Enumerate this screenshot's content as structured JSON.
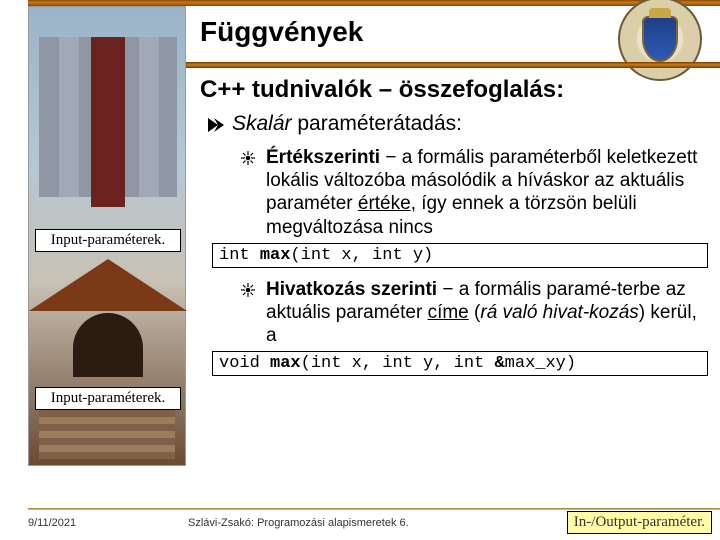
{
  "header": {
    "title": "Függvények",
    "subtitle": "C++ tudnivalók – összefoglalás:"
  },
  "left": {
    "label1": "Input-paraméterek.",
    "label2": "Input-paraméterek."
  },
  "body": {
    "l1_prefix_italic": "Skalár",
    "l1_rest": " paraméterátadás:",
    "item1_bold": "Értékszerinti",
    "item1_dash": " − ",
    "item1_rest": "a formális paraméterből keletkezett lokális változóba másolódik a híváskor az aktuális paraméter ",
    "item1_ul": "értéke",
    "item1_rest2": ", így ennek a törzsön belüli megváltozása nincs",
    "code1_prefix": "int ",
    "code1_bold": "max",
    "code1_rest": "(int x, int y)",
    "item2_bold": "Hivatkozás szerinti",
    "item2_dash": " − ",
    "item2_rest": "a formális paramé-terbe az aktuális paraméter ",
    "item2_ul": "címe",
    "item2_rest2": " (",
    "item2_ital": "rá való hivat-kozás",
    "item2_rest3": ") kerül, a",
    "code2_prefix": "void ",
    "code2_bold": "max",
    "code2_rest1": "(int x, int y, int ",
    "code2_amp": "&",
    "code2_rest2": "max_xy)"
  },
  "footer": {
    "date": "9/11/2021",
    "mid": "Szlávi-Zsakó: Programozási alapismeretek 6.",
    "tag": "In-/Output-paraméter."
  },
  "icons": {
    "arrow": "chevron-arrow-icon",
    "sun": "sunburst-bullet-icon",
    "crest": "university-crest-icon"
  }
}
